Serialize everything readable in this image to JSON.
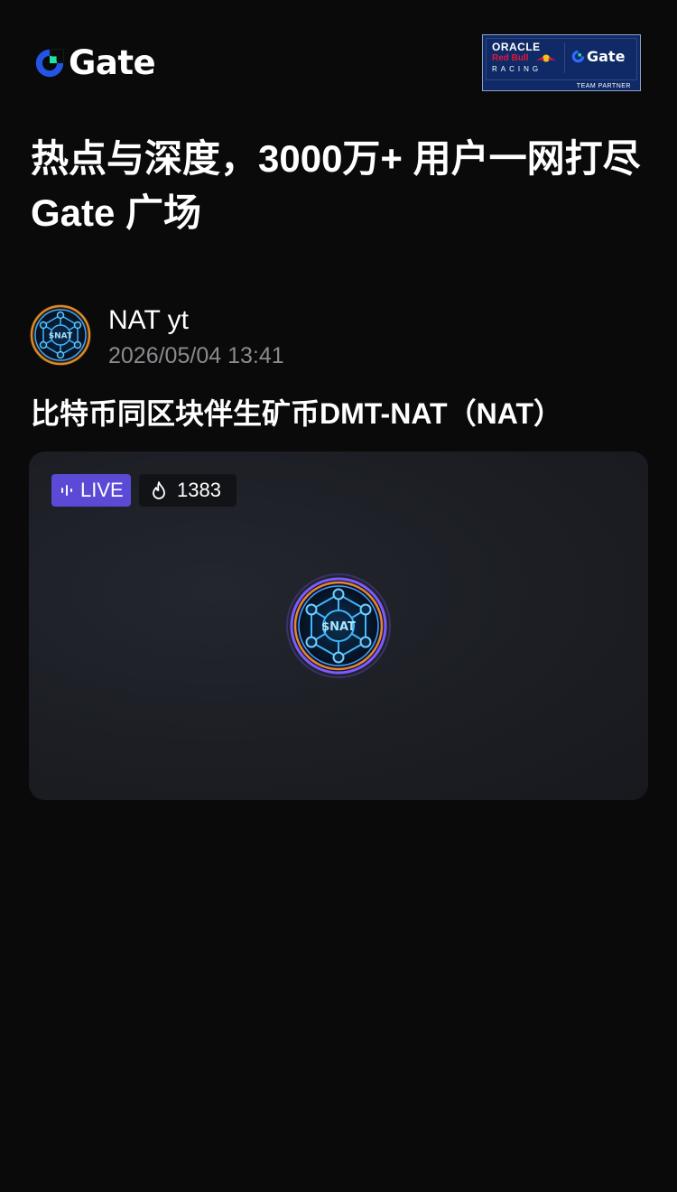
{
  "header": {
    "brand_name": "Gate",
    "partner_badge": {
      "oracle": "ORACLE",
      "redbull": "Red Bull",
      "racing": "RACING",
      "brand": "Gate",
      "team_partner": "TEAM PARTNER"
    }
  },
  "headline": "热点与深度，3000万+ 用户一网打尽 Gate 广场",
  "author": {
    "name": "NAT yt",
    "time": "2026/05/04 13:41",
    "avatar_text": "$NAT"
  },
  "post": {
    "title": "比特币同区块伴生矿币DMT-NAT（NAT）"
  },
  "live_card": {
    "live_label": "LIVE",
    "viewer_count": "1383",
    "stream_logo_text": "$NAT"
  },
  "colors": {
    "background": "#0a0a0b",
    "brand_blue": "#2354e6",
    "brand_green": "#17e5a1",
    "live_purple": "#5b4ad6",
    "muted_text": "#8a8a8f",
    "card_bg": "#1c1e24"
  },
  "icons": {
    "logo": "gate-logo-icon",
    "live": "sound-wave-icon",
    "viewers": "flame-icon",
    "avatar": "network-node-icon"
  }
}
